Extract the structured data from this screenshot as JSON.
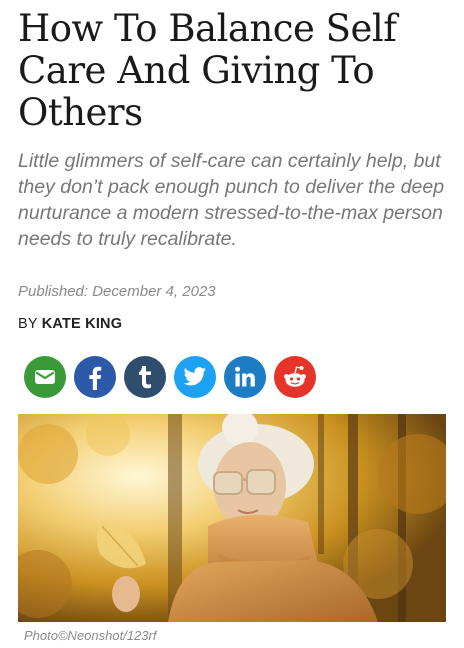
{
  "article": {
    "title": "How To Balance Self Care And Giving To Others",
    "subtitle": "Little glimmers of self-care can certainly help, but they don’t pack enough punch to deliver the deep nurturance a modern stressed-to-the-max person needs to truly recalibrate.",
    "published": "Published: December 4, 2023",
    "byline_prefix": "BY",
    "author": "KATE KING",
    "photo_credit": "Photo©Neonshot/123rf"
  },
  "share": [
    {
      "name": "email",
      "icon": "email-icon",
      "color": "#3a9a3a"
    },
    {
      "name": "facebook",
      "icon": "facebook-icon",
      "color": "#2d5aa8"
    },
    {
      "name": "tumblr",
      "icon": "tumblr-icon",
      "color": "#2f4e6e"
    },
    {
      "name": "twitter",
      "icon": "twitter-icon",
      "color": "#1da1f2"
    },
    {
      "name": "linkedin",
      "icon": "linkedin-icon",
      "color": "#1c7cc4"
    },
    {
      "name": "reddit",
      "icon": "reddit-icon",
      "color": "#e5352a"
    }
  ]
}
